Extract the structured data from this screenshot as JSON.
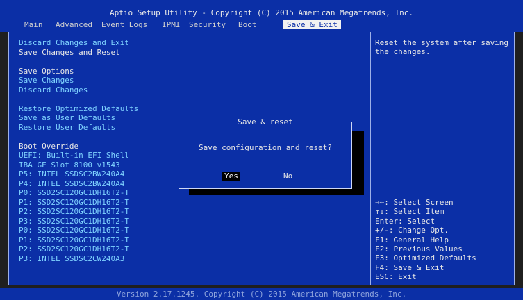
{
  "title": "Aptio Setup Utility - Copyright (C) 2015 American Megatrends, Inc.",
  "tabs": [
    "Main",
    "Advanced",
    "Event Logs",
    "IPMI",
    "Security",
    "Boot",
    "Save & Exit"
  ],
  "menu": {
    "discard_changes_and_exit": "Discard Changes and Exit",
    "save_changes_and_reset": "Save Changes and Reset",
    "save_options": "Save Options",
    "save_changes": "Save Changes",
    "discard_changes": "Discard Changes",
    "restore_optimized_defaults": "Restore Optimized Defaults",
    "save_as_user_defaults": "Save as User Defaults",
    "restore_user_defaults": "Restore User Defaults",
    "boot_override": "Boot Override",
    "boot_devices": [
      "UEFI: Built-in EFI Shell",
      "IBA GE Slot 8100 v1543",
      "P5: INTEL SSDSC2BW240A4",
      "P4: INTEL SSDSC2BW240A4",
      "P0: SSD2SC120GC1DH16T2-T",
      "P1: SSD2SC120GC1DH16T2-T",
      "P2: SSD2SC120GC1DH16T2-T",
      "P3: SSD2SC120GC1DH16T2-T",
      "P0: SSD2SC120GC1DH16T2-T",
      "P1: SSD2SC120GC1DH16T2-T",
      "P2: SSD2SC120GC1DH16T2-T",
      "P3: INTEL SSDSC2CW240A3"
    ]
  },
  "help_text": "Reset the system after saving the changes.",
  "keys": [
    "→←: Select Screen",
    "↑↓: Select Item",
    "Enter: Select",
    "+/-: Change Opt.",
    "F1: General Help",
    "F2: Previous Values",
    "F3: Optimized Defaults",
    "F4: Save & Exit",
    "ESC: Exit"
  ],
  "dialog": {
    "title": "Save & reset",
    "message": "Save configuration and reset?",
    "yes": "Yes",
    "no": "No"
  },
  "footer": "Version 2.17.1245. Copyright (C) 2015 American Megatrends, Inc.",
  "colors": {
    "panel_blue": "#0b2fa6",
    "option_cyan": "#7fd3ff",
    "text_white": "#e6e6e6"
  }
}
